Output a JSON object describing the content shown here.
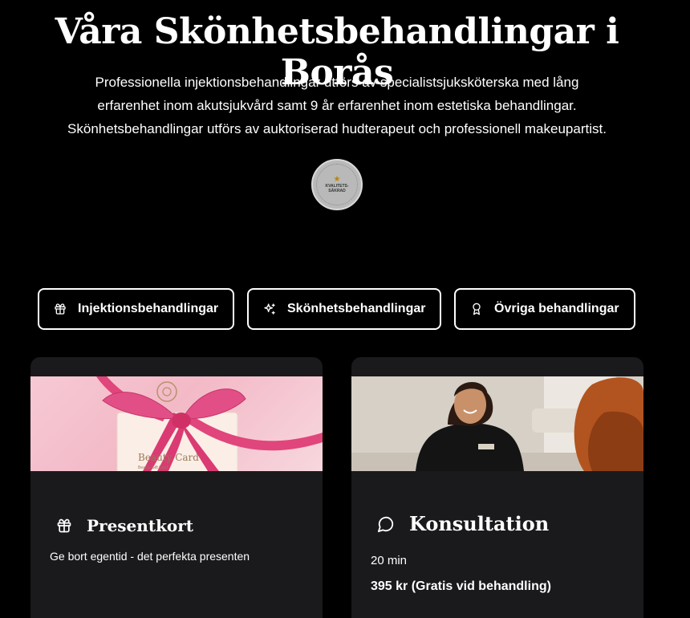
{
  "header": {
    "title": "Våra Skönhetsbehandlingar i Borås",
    "intro_line1": "Professionella injektionsbehandlingar utförs av specialistsjuksköterska med lång",
    "intro_line2": "erfarenhet inom akutsjukvård samt 9 år erfarenhet inom estetiska behandlingar.",
    "intro_line3": "Skönhetsbehandlingar utförs av auktoriserad hudterapeut och professionell makeupartist.",
    "badge_line1": "KVALITETS-",
    "badge_line2": "SÄKRAD"
  },
  "tabs": [
    {
      "label": "Injektionsbehandlingar",
      "icon": "gift-icon"
    },
    {
      "label": "Skönhetsbehandlingar",
      "icon": "sparkles-icon"
    },
    {
      "label": "Övriga behandlingar",
      "icon": "award-icon"
    }
  ],
  "cards": {
    "gift": {
      "title": "Presentkort",
      "description": "Ge bort egentid - det perfekta presenten",
      "image_text": "Beauty Card",
      "image_subtext": "Beauty Gift Card",
      "icon": "gift-icon"
    },
    "consult": {
      "title": "Konsultation",
      "duration": "20 min",
      "price": "395 kr (Gratis vid behandling)",
      "icon": "chat-bubble-icon"
    }
  },
  "colors": {
    "background": "#000000",
    "card_background": "#1a1a1c",
    "ribbon_pink": "#e0457b"
  }
}
